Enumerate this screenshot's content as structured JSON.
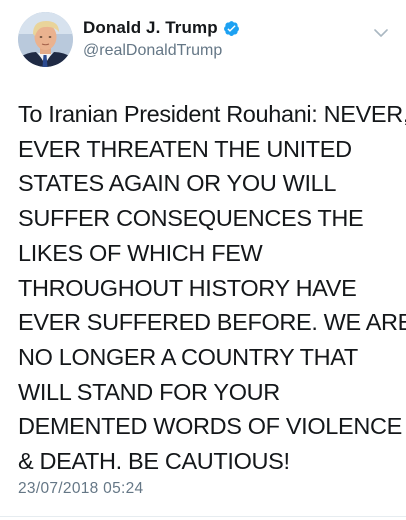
{
  "user": {
    "display_name": "Donald J. Trump",
    "handle": "@realDonaldTrump",
    "verified": true,
    "verified_color": "#1da1f2"
  },
  "tweet": {
    "text_lines": [
      "To Iranian President Rouhani: NEVER,",
      "EVER THREATEN THE UNITED",
      "STATES AGAIN OR YOU WILL",
      "SUFFER CONSEQUENCES THE",
      "LIKES OF WHICH FEW",
      "THROUGHOUT HISTORY HAVE",
      "EVER SUFFERED BEFORE. WE ARE",
      "NO LONGER A COUNTRY THAT",
      "WILL STAND FOR YOUR",
      "DEMENTED WORDS OF VIOLENCE",
      "& DEATH. BE CAUTIOUS!"
    ],
    "timestamp": "23/07/2018 05:24"
  },
  "icons": {
    "avatar": "profile-photo",
    "verified": "verified-badge-icon",
    "menu": "chevron-down-icon"
  },
  "colors": {
    "text": "#14171a",
    "secondary": "#657786",
    "divider": "#e6ecf0"
  }
}
